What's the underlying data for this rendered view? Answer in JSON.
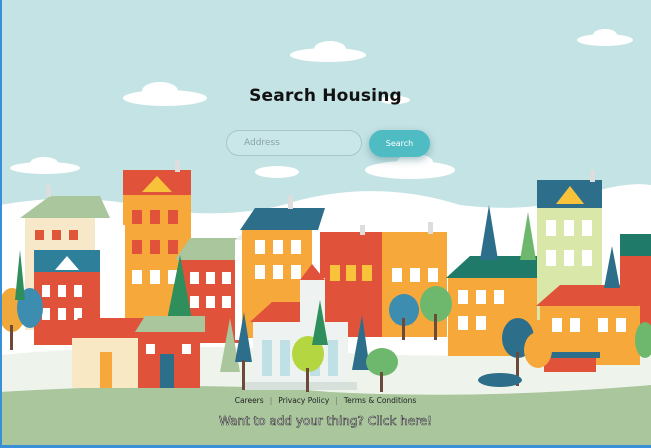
{
  "page": {
    "title": "Search Housing"
  },
  "search": {
    "placeholder": "Address",
    "value": "",
    "button_label": "Search"
  },
  "footer": {
    "links": [
      {
        "label": "Careers"
      },
      {
        "label": "Privacy Policy"
      },
      {
        "label": "Terms & Conditions"
      }
    ],
    "promo": "Want to add your thing? Click here!"
  },
  "colors": {
    "sky": "#c4e3e5",
    "accent": "#4fbcc3",
    "ground": "#a9c69c"
  }
}
